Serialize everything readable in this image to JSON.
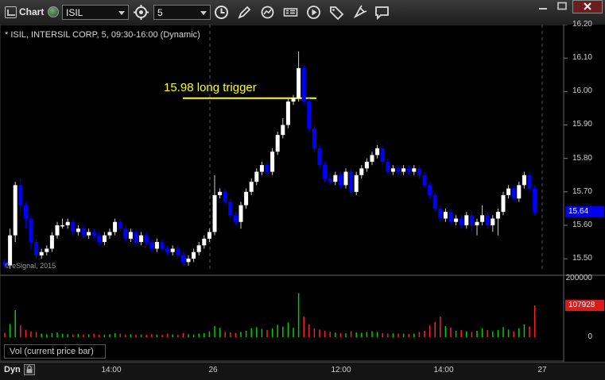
{
  "toolbar": {
    "title": "Chart",
    "symbol": "ISIL",
    "interval": "5",
    "icons": [
      "chart-window-icon",
      "link-icon",
      "symbol-caret-icon",
      "compare-icon",
      "interval-caret-icon",
      "time-icon",
      "draw-icon",
      "refresh-icon",
      "cursor-data-icon",
      "play-icon",
      "tag-icon",
      "comment-icon"
    ]
  },
  "chart": {
    "label": "* ISIL, INTERSIL CORP, 5, 09:30-16:00 (Dynamic)",
    "watermark": "© eSignal, 2015",
    "annotation": "15.98 long trigger",
    "current_price": "15.64",
    "volume_label": "Vol (current price bar)",
    "current_volume": "107928",
    "mode": "Dyn",
    "colors": {
      "up": "#ffffff",
      "down": "#0000ff",
      "annotation": "#ffff00",
      "vol_up": "#00cc00",
      "vol_down": "#ff2020"
    }
  },
  "chart_data": {
    "type": "candlestick",
    "price_axis": {
      "ticks": [
        "16.20",
        "16.10",
        "16.00",
        "15.90",
        "15.80",
        "15.70",
        "15.60",
        "15.50"
      ],
      "ylim": [
        15.46,
        16.2
      ]
    },
    "time_axis": {
      "ticks": [
        "14:00",
        "26",
        "12:00",
        "14:00",
        "27"
      ]
    },
    "volume_axis": {
      "ticks": [
        "200000",
        "0"
      ],
      "ylim": [
        0,
        200000
      ]
    },
    "annotation_level": 15.98,
    "candles": [
      [
        15.49,
        15.48,
        15.47,
        15.5
      ],
      [
        15.48,
        15.57,
        15.47,
        15.59
      ],
      [
        15.57,
        15.72,
        15.55,
        15.73
      ],
      [
        15.72,
        15.66,
        15.64,
        15.74
      ],
      [
        15.66,
        15.62,
        15.59,
        15.67
      ],
      [
        15.62,
        15.55,
        15.53,
        15.63
      ],
      [
        15.55,
        15.51,
        15.5,
        15.56
      ],
      [
        15.51,
        15.52,
        15.5,
        15.53
      ],
      [
        15.52,
        15.53,
        15.51,
        15.54
      ],
      [
        15.53,
        15.57,
        15.52,
        15.58
      ],
      [
        15.57,
        15.6,
        15.56,
        15.61
      ],
      [
        15.6,
        15.6,
        15.59,
        15.62
      ],
      [
        15.6,
        15.61,
        15.59,
        15.62
      ],
      [
        15.61,
        15.58,
        15.57,
        15.62
      ],
      [
        15.58,
        15.59,
        15.57,
        15.6
      ],
      [
        15.59,
        15.57,
        15.56,
        15.6
      ],
      [
        15.57,
        15.58,
        15.56,
        15.59
      ],
      [
        15.58,
        15.57,
        15.56,
        15.59
      ],
      [
        15.57,
        15.55,
        15.54,
        15.58
      ],
      [
        15.55,
        15.57,
        15.54,
        15.58
      ],
      [
        15.57,
        15.58,
        15.56,
        15.59
      ],
      [
        15.58,
        15.61,
        15.57,
        15.62
      ],
      [
        15.61,
        15.59,
        15.58,
        15.62
      ],
      [
        15.59,
        15.56,
        15.55,
        15.6
      ],
      [
        15.56,
        15.58,
        15.55,
        15.59
      ],
      [
        15.58,
        15.55,
        15.54,
        15.59
      ],
      [
        15.55,
        15.57,
        15.54,
        15.58
      ],
      [
        15.57,
        15.55,
        15.54,
        15.58
      ],
      [
        15.55,
        15.53,
        15.52,
        15.56
      ],
      [
        15.53,
        15.55,
        15.52,
        15.56
      ],
      [
        15.55,
        15.53,
        15.52,
        15.56
      ],
      [
        15.53,
        15.52,
        15.51,
        15.54
      ],
      [
        15.52,
        15.53,
        15.51,
        15.54
      ],
      [
        15.53,
        15.51,
        15.5,
        15.54
      ],
      [
        15.51,
        15.49,
        15.48,
        15.52
      ],
      [
        15.49,
        15.5,
        15.48,
        15.51
      ],
      [
        15.5,
        15.52,
        15.49,
        15.53
      ],
      [
        15.52,
        15.54,
        15.51,
        15.55
      ],
      [
        15.54,
        15.56,
        15.53,
        15.57
      ],
      [
        15.56,
        15.58,
        15.55,
        15.59
      ],
      [
        15.58,
        15.69,
        15.57,
        15.75
      ],
      [
        15.69,
        15.7,
        15.68,
        15.71
      ],
      [
        15.7,
        15.67,
        15.66,
        15.71
      ],
      [
        15.67,
        15.63,
        15.62,
        15.68
      ],
      [
        15.63,
        15.61,
        15.6,
        15.64
      ],
      [
        15.61,
        15.66,
        15.59,
        15.67
      ],
      [
        15.66,
        15.7,
        15.65,
        15.71
      ],
      [
        15.7,
        15.73,
        15.69,
        15.74
      ],
      [
        15.73,
        15.76,
        15.72,
        15.77
      ],
      [
        15.76,
        15.78,
        15.75,
        15.79
      ],
      [
        15.78,
        15.76,
        15.75,
        15.79
      ],
      [
        15.76,
        15.82,
        15.75,
        15.83
      ],
      [
        15.82,
        15.87,
        15.81,
        15.88
      ],
      [
        15.87,
        15.9,
        15.86,
        15.92
      ],
      [
        15.9,
        15.97,
        15.89,
        15.98
      ],
      [
        15.97,
        15.98,
        15.96,
        15.99
      ],
      [
        15.98,
        16.07,
        15.97,
        16.12
      ],
      [
        16.07,
        15.97,
        15.96,
        16.08
      ],
      [
        15.97,
        15.89,
        15.88,
        15.98
      ],
      [
        15.89,
        15.83,
        15.82,
        15.9
      ],
      [
        15.83,
        15.78,
        15.77,
        15.84
      ],
      [
        15.78,
        15.74,
        15.73,
        15.79
      ],
      [
        15.74,
        15.73,
        15.72,
        15.76
      ],
      [
        15.73,
        15.75,
        15.72,
        15.76
      ],
      [
        15.75,
        15.72,
        15.71,
        15.76
      ],
      [
        15.72,
        15.76,
        15.71,
        15.77
      ],
      [
        15.76,
        15.7,
        15.69,
        15.77
      ],
      [
        15.7,
        15.75,
        15.69,
        15.76
      ],
      [
        15.75,
        15.77,
        15.74,
        15.78
      ],
      [
        15.77,
        15.79,
        15.76,
        15.8
      ],
      [
        15.79,
        15.81,
        15.78,
        15.82
      ],
      [
        15.81,
        15.83,
        15.8,
        15.84
      ],
      [
        15.83,
        15.79,
        15.78,
        15.84
      ],
      [
        15.79,
        15.76,
        15.75,
        15.8
      ],
      [
        15.76,
        15.77,
        15.75,
        15.78
      ],
      [
        15.77,
        15.76,
        15.75,
        15.78
      ],
      [
        15.76,
        15.77,
        15.75,
        15.78
      ],
      [
        15.77,
        15.76,
        15.75,
        15.78
      ],
      [
        15.76,
        15.77,
        15.75,
        15.78
      ],
      [
        15.77,
        15.75,
        15.74,
        15.78
      ],
      [
        15.75,
        15.72,
        15.71,
        15.76
      ],
      [
        15.72,
        15.69,
        15.68,
        15.73
      ],
      [
        15.69,
        15.65,
        15.64,
        15.7
      ],
      [
        15.65,
        15.62,
        15.61,
        15.66
      ],
      [
        15.62,
        15.64,
        15.61,
        15.65
      ],
      [
        15.64,
        15.61,
        15.6,
        15.65
      ],
      [
        15.61,
        15.62,
        15.6,
        15.63
      ],
      [
        15.62,
        15.6,
        15.59,
        15.63
      ],
      [
        15.6,
        15.63,
        15.59,
        15.64
      ],
      [
        15.63,
        15.6,
        15.58,
        15.64
      ],
      [
        15.6,
        15.61,
        15.57,
        15.62
      ],
      [
        15.61,
        15.63,
        15.6,
        15.66
      ],
      [
        15.63,
        15.6,
        15.59,
        15.64
      ],
      [
        15.6,
        15.62,
        15.58,
        15.63
      ],
      [
        15.62,
        15.64,
        15.57,
        15.65
      ],
      [
        15.64,
        15.69,
        15.63,
        15.7
      ],
      [
        15.69,
        15.71,
        15.68,
        15.72
      ],
      [
        15.71,
        15.68,
        15.67,
        15.72
      ],
      [
        15.68,
        15.72,
        15.67,
        15.73
      ],
      [
        15.72,
        15.75,
        15.71,
        15.76
      ],
      [
        15.75,
        15.71,
        15.7,
        15.76
      ],
      [
        15.71,
        15.64,
        15.63,
        15.72
      ]
    ],
    "volume": [
      15000,
      45000,
      92000,
      40000,
      25000,
      20000,
      18000,
      12000,
      10000,
      14000,
      16000,
      12000,
      10000,
      9000,
      11000,
      9000,
      10000,
      12000,
      9000,
      8000,
      10000,
      14000,
      12000,
      9000,
      10000,
      8000,
      9000,
      8000,
      10000,
      9000,
      8000,
      12000,
      9000,
      8000,
      14000,
      10000,
      9000,
      12000,
      14000,
      20000,
      38000,
      32000,
      18000,
      16000,
      14000,
      18000,
      22000,
      30000,
      34000,
      28000,
      24000,
      30000,
      42000,
      36000,
      50000,
      32000,
      150000,
      70000,
      44000,
      30000,
      26000,
      22000,
      18000,
      16000,
      14000,
      13000,
      20000,
      16000,
      15000,
      18000,
      20000,
      18000,
      14000,
      12000,
      13000,
      12000,
      12000,
      11000,
      12000,
      18000,
      22000,
      40000,
      52000,
      70000,
      38000,
      32000,
      22000,
      24000,
      20000,
      18000,
      22000,
      30000,
      24000,
      20000,
      24000,
      34000,
      26000,
      20000,
      30000,
      44000,
      36000,
      108000
    ]
  }
}
